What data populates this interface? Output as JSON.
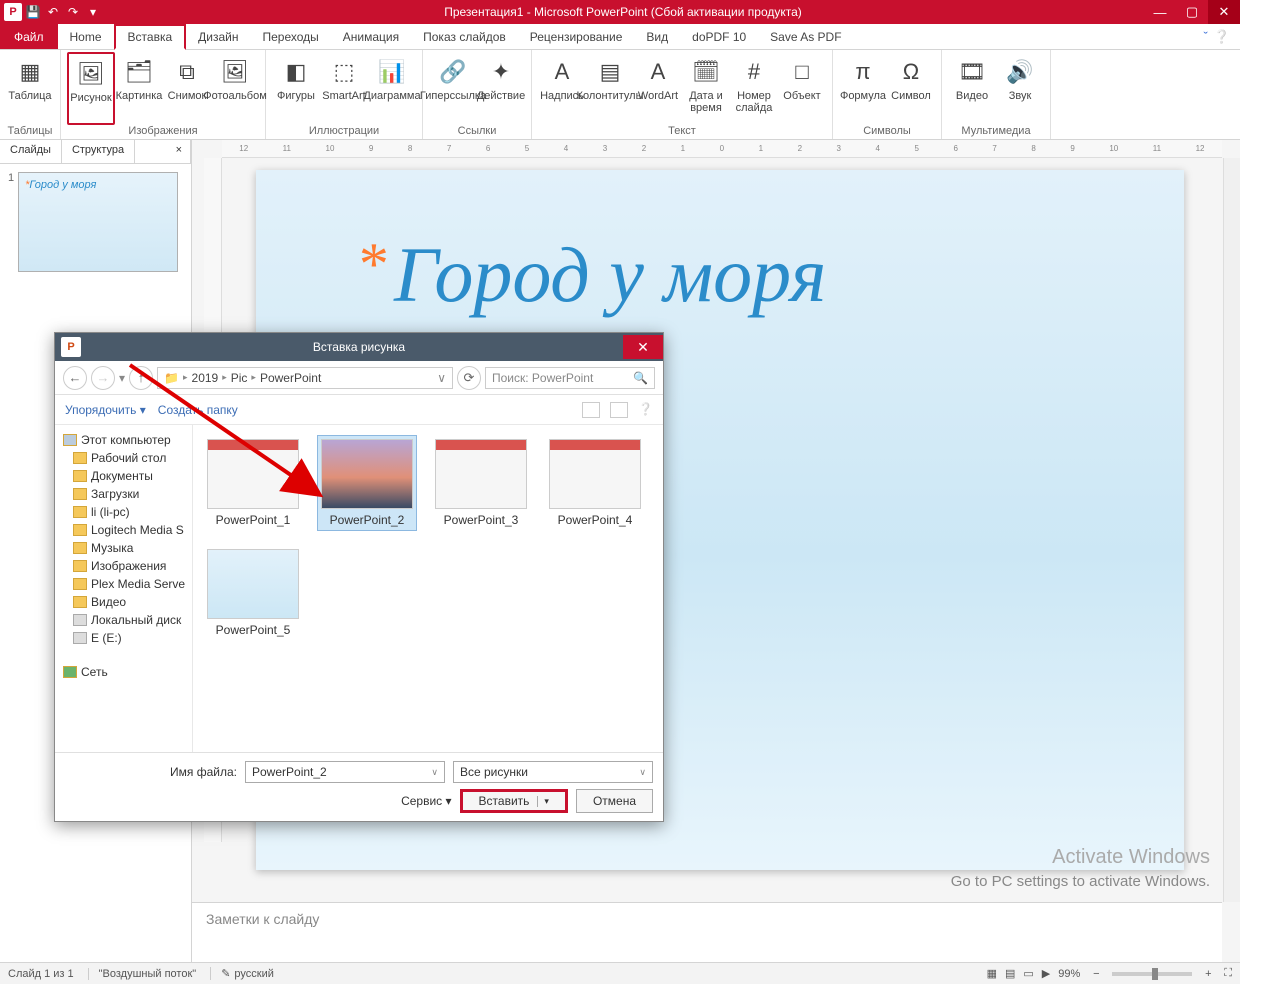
{
  "window": {
    "title": "Презентация1 - Microsoft PowerPoint (Сбой активации продукта)"
  },
  "tabs": {
    "file": "Файл",
    "items": [
      "Home",
      "Вставка",
      "Дизайн",
      "Переходы",
      "Анимация",
      "Показ слайдов",
      "Рецензирование",
      "Вид",
      "doPDF 10",
      "Save As PDF"
    ],
    "activeIndex": 1
  },
  "ribbon": {
    "groups": [
      {
        "label": "Таблицы",
        "buttons": [
          {
            "label": "Таблица",
            "icon": "▦"
          }
        ]
      },
      {
        "label": "Изображения",
        "buttons": [
          {
            "label": "Рисунок",
            "icon": "🖼",
            "highlight": true
          },
          {
            "label": "Картинка",
            "icon": "🗂"
          },
          {
            "label": "Снимок",
            "icon": "⧉"
          },
          {
            "label": "Фотоальбом",
            "icon": "🖼"
          }
        ]
      },
      {
        "label": "Иллюстрации",
        "buttons": [
          {
            "label": "Фигуры",
            "icon": "◧"
          },
          {
            "label": "SmartArt",
            "icon": "⬚"
          },
          {
            "label": "Диаграмма",
            "icon": "📊"
          }
        ]
      },
      {
        "label": "Ссылки",
        "buttons": [
          {
            "label": "Гиперссылка",
            "icon": "🔗"
          },
          {
            "label": "Действие",
            "icon": "✦"
          }
        ]
      },
      {
        "label": "Текст",
        "buttons": [
          {
            "label": "Надпись",
            "icon": "A"
          },
          {
            "label": "Колонтитулы",
            "icon": "▤"
          },
          {
            "label": "WordArt",
            "icon": "A"
          },
          {
            "label": "Дата и время",
            "icon": "🗓"
          },
          {
            "label": "Номер слайда",
            "icon": "#"
          },
          {
            "label": "Объект",
            "icon": "□"
          }
        ]
      },
      {
        "label": "Символы",
        "buttons": [
          {
            "label": "Формула",
            "icon": "π"
          },
          {
            "label": "Символ",
            "icon": "Ω"
          }
        ]
      },
      {
        "label": "Мультимедиа",
        "buttons": [
          {
            "label": "Видео",
            "icon": "🎞"
          },
          {
            "label": "Звук",
            "icon": "🔊"
          }
        ]
      }
    ]
  },
  "leftpane": {
    "tab_slides": "Слайды",
    "tab_outline": "Структура",
    "thumbs": [
      {
        "num": "1",
        "title": "Город у моря"
      }
    ]
  },
  "slide": {
    "title": "Город у моря"
  },
  "notes": {
    "placeholder": "Заметки к слайду"
  },
  "ruler_ticks": [
    "12",
    "11",
    "10",
    "9",
    "8",
    "7",
    "6",
    "5",
    "4",
    "3",
    "2",
    "1",
    "0",
    "1",
    "2",
    "3",
    "4",
    "5",
    "6",
    "7",
    "8",
    "9",
    "10",
    "11",
    "12"
  ],
  "watermark": {
    "h": "Activate Windows",
    "s": "Go to PC settings to activate Windows."
  },
  "status": {
    "slide": "Слайд 1 из 1",
    "theme": "\"Воздушный поток\"",
    "lang": "русский",
    "zoom": "99%"
  },
  "dialog": {
    "title": "Вставка рисунка",
    "path": [
      "2019",
      "Pic",
      "PowerPoint"
    ],
    "search_placeholder": "Поиск: PowerPoint",
    "organize": "Упорядочить",
    "newfolder": "Создать папку",
    "tree": [
      {
        "label": "Этот компьютер",
        "cls": "pc"
      },
      {
        "label": "Рабочий стол",
        "cls": "indent"
      },
      {
        "label": "Документы",
        "cls": "indent"
      },
      {
        "label": "Загрузки",
        "cls": "indent"
      },
      {
        "label": "li (li-pc)",
        "cls": "indent"
      },
      {
        "label": "Logitech Media S",
        "cls": "indent"
      },
      {
        "label": "Музыка",
        "cls": "indent"
      },
      {
        "label": "Изображения",
        "cls": "indent"
      },
      {
        "label": "Plex Media Serve",
        "cls": "indent"
      },
      {
        "label": "Видео",
        "cls": "indent"
      },
      {
        "label": "Локальный диск",
        "cls": "indent dr"
      },
      {
        "label": "E (E:)",
        "cls": "indent dr"
      },
      {
        "label": "Сеть",
        "cls": "net"
      }
    ],
    "files": [
      {
        "name": "PowerPoint_1",
        "kind": "ppt"
      },
      {
        "name": "PowerPoint_2",
        "kind": "photo",
        "selected": true
      },
      {
        "name": "PowerPoint_3",
        "kind": "ppt"
      },
      {
        "name": "PowerPoint_4",
        "kind": "ppt"
      },
      {
        "name": "PowerPoint_5",
        "kind": "slide"
      }
    ],
    "filename_label": "Имя файла:",
    "filename_value": "PowerPoint_2",
    "filter": "Все рисунки",
    "tools": "Сервис",
    "insert": "Вставить",
    "cancel": "Отмена"
  }
}
